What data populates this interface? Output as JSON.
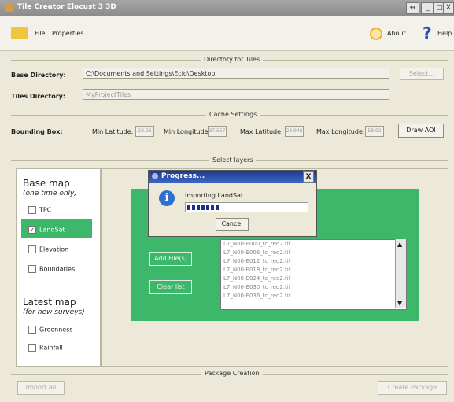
{
  "window": {
    "title": "Tile Creator Elocust 3 3D",
    "controls": [
      "↔",
      "_",
      "□",
      "X"
    ]
  },
  "menu": {
    "file": "File",
    "properties": "Properties",
    "about": "About",
    "help": "Help"
  },
  "directory": {
    "section_title": "Directory for Tiles",
    "base_label": "Base Directory:",
    "base_value": "C:\\Documents and Settings\\Eclo\\Desktop",
    "select_button": "Select...",
    "tiles_label": "Tiles Directory:",
    "tiles_value": "MyProjectTiles"
  },
  "cache": {
    "section_title": "Cache Settings",
    "bbox_label": "Bounding Box:",
    "min_lat_label": "Min Latitude:",
    "min_lat_value": "23.06",
    "min_lon_label": "Min Longitude:",
    "min_lon_value": "37.557",
    "max_lat_label": "Max Latitude:",
    "max_lat_value": "23.946",
    "max_lon_label": "Max Longitude:",
    "max_lon_value": "58.92",
    "draw_button": "Draw AOI"
  },
  "layers": {
    "section_title": "Select layers",
    "base_map_title": "Base map",
    "base_map_sub": "(one time only)",
    "base_items": [
      {
        "label": "TPC",
        "checked": false
      },
      {
        "label": "LandSat",
        "checked": true
      },
      {
        "label": "Elevation",
        "checked": false
      },
      {
        "label": "Boundaries",
        "checked": false
      }
    ],
    "latest_map_title": "Latest map",
    "latest_map_sub": "(for new surveys)",
    "latest_items": [
      {
        "label": "Greenness",
        "checked": false
      },
      {
        "label": "Rainfall",
        "checked": false
      }
    ],
    "add_button": "Add File(s)",
    "clear_button": "Clear list",
    "files": [
      "L7_N00-E000_tc_red2.tif",
      "L7_N00-E006_tc_red2.tif",
      "L7_N00-E012_tc_red2.tif",
      "L7_N00-E018_tc_red2.tif",
      "L7_N00-E024_tc_red2.tif",
      "L7_N00-E030_tc_red2.tif",
      "L7_N00-E036_tc_red2.tif"
    ]
  },
  "dialog": {
    "title": "Progress...",
    "message": "Importing LandSat",
    "progress": 0.3,
    "cancel_button": "Cancel",
    "close": "X"
  },
  "package": {
    "section_title": "Package Creation",
    "import_button": "Import all",
    "create_button": "Create Package"
  }
}
